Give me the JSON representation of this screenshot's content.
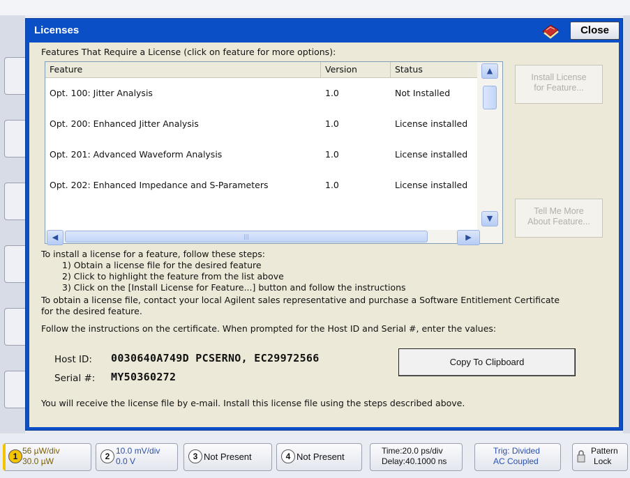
{
  "dialog": {
    "title": "Licenses",
    "close_label": "Close",
    "help_icon": "help-book-icon"
  },
  "caption": "Features That Require a License (click on feature for more options):",
  "list": {
    "headers": [
      "Feature",
      "Version",
      "Status"
    ],
    "rows": [
      {
        "feature": "Opt. 100: Jitter Analysis",
        "version": "1.0",
        "status": "Not Installed"
      },
      {
        "feature": "Opt. 200: Enhanced Jitter Analysis",
        "version": "1.0",
        "status": "License installed"
      },
      {
        "feature": "Opt. 201: Advanced Waveform Analysis",
        "version": "1.0",
        "status": "License installed"
      },
      {
        "feature": "Opt. 202: Enhanced Impedance and S-Parameters",
        "version": "1.0",
        "status": "License installed"
      }
    ],
    "scroll_up_icon": "chevron-up-icon",
    "scroll_down_icon": "chevron-down-icon",
    "scroll_left_icon": "chevron-left-icon",
    "scroll_right_icon": "chevron-right-icon"
  },
  "buttons": {
    "install_line1": "Install License",
    "install_line2": "for Feature...",
    "tell_line1": "Tell Me More",
    "tell_line2": "About Feature...",
    "copy": "Copy To Clipboard"
  },
  "instructions": {
    "intro": "To install a license for a feature, follow these steps:",
    "step1": "1) Obtain a license file for the desired feature",
    "step2": "2) Click to highlight the feature from the list above",
    "step3": "3) Click on the [Install License for Feature...] button and follow the instructions",
    "obtain_line1": "To obtain a license file, contact your local Agilent sales representative and purchase a Software Entitlement Certificate",
    "obtain_line2": "for the desired feature.",
    "follow": "Follow the instructions on the certificate.  When prompted for the Host ID and Serial #, enter the values:",
    "receive": "You will receive the license file by e-mail.  Install this license file using the steps described above."
  },
  "ids": {
    "host_label": "Host ID:",
    "host_value": "0030640A749D  PCSERNO, EC29972566",
    "serial_label": "Serial #:",
    "serial_value": "MY50360272"
  },
  "statusbar": {
    "ch1_num": "1",
    "ch1_line1": "56 µW/div",
    "ch1_line2": "30.0 µW",
    "ch2_num": "2",
    "ch2_line1": "10.0 mV/div",
    "ch2_line2": "0.0 V",
    "ch3_num": "3",
    "ch3_label": "Not Present",
    "ch4_num": "4",
    "ch4_label": "Not Present",
    "time_line1": "Time:20.0 ps/div",
    "time_line2": "Delay:40.1000 ns",
    "trig_line1": "Trig: Divided",
    "trig_line2": "AC Coupled",
    "pattern_line1": "Pattern",
    "pattern_line2": "Lock"
  },
  "colors": {
    "dialog_frame": "#0a4fc6",
    "client_bg": "#ece9d8",
    "ch1": "#f5c400",
    "trig_text": "#2a4fb0"
  }
}
